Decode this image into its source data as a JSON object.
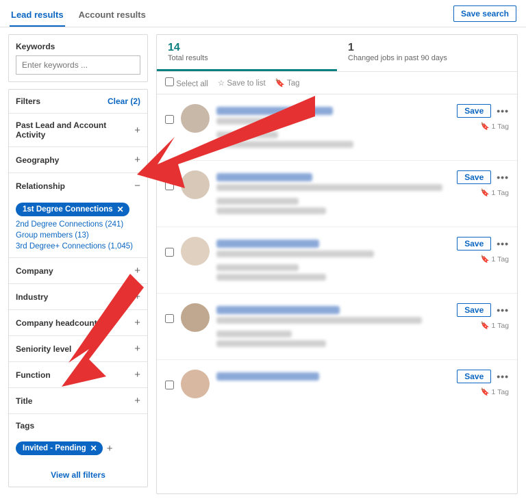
{
  "tabs": {
    "lead": "Lead results",
    "account": "Account results"
  },
  "save_search": "Save search",
  "keywords": {
    "label": "Keywords",
    "placeholder": "Enter keywords ..."
  },
  "filters_header": {
    "title": "Filters",
    "clear": "Clear (2)"
  },
  "filters": {
    "past": "Past Lead and Account Activity",
    "geography": "Geography",
    "relationship": "Relationship",
    "company": "Company",
    "industry": "Industry",
    "headcount": "Company headcount",
    "seniority": "Seniority level",
    "function": "Function",
    "title": "Title",
    "tags": "Tags"
  },
  "relationship": {
    "selected": "1st Degree Connections",
    "opt2": "2nd Degree Connections (241)",
    "opt3": "Group members (13)",
    "opt4": "3rd Degree+ Connections (1,045)"
  },
  "tags_selected": "Invited - Pending",
  "view_all": "View all filters",
  "stats": {
    "total_num": "14",
    "total_lbl": "Total results",
    "changed_num": "1",
    "changed_lbl": "Changed jobs in past 90 days"
  },
  "selbar": {
    "select_all": "Select all",
    "save_to_list": "Save to list",
    "tag": "Tag"
  },
  "result_actions": {
    "save": "Save",
    "tag_count": "1 Tag"
  }
}
